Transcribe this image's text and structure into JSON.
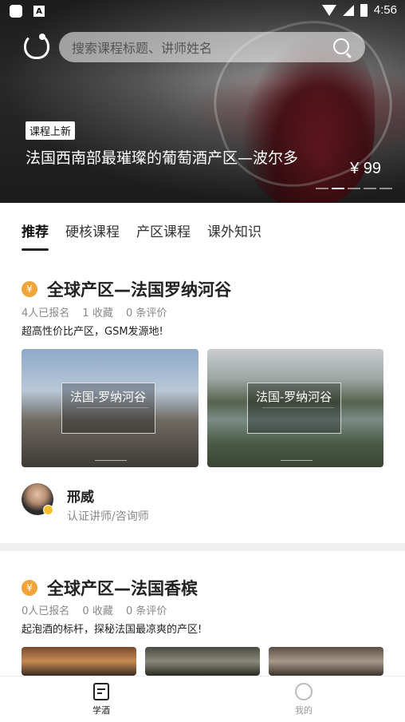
{
  "status_bar": {
    "time": "4:56",
    "left_icons": [
      "app-icon",
      "a-icon"
    ],
    "right_icons": [
      "wifi-icon",
      "signal-icon",
      "battery-icon"
    ]
  },
  "search": {
    "placeholder": "搜索课程标题、讲师姓名"
  },
  "hero": {
    "badge": "课程上新",
    "title": "法国西南部最璀璨的葡萄酒产区—波尔多",
    "price": "¥ 99",
    "dots_total": 5,
    "dots_active_index": 1
  },
  "tabs": [
    {
      "label": "推荐",
      "active": true
    },
    {
      "label": "硬核课程",
      "active": false
    },
    {
      "label": "产区课程",
      "active": false
    },
    {
      "label": "课外知识",
      "active": false
    }
  ],
  "courses": [
    {
      "title": "全球产区—法国罗纳河谷",
      "meta": {
        "enrolled": "4人已报名",
        "favorites": "1 收藏",
        "reviews": "0 条评价"
      },
      "desc": "超高性价比产区，GSM发源地!",
      "thumbs": [
        {
          "label": "法国-罗纳河谷"
        },
        {
          "label": "法国-罗纳河谷"
        }
      ],
      "lecturer": {
        "name": "邢威",
        "role": "认证讲师/咨询师"
      }
    },
    {
      "title": "全球产区—法国香槟",
      "meta": {
        "enrolled": "0人已报名",
        "favorites": "0 收藏",
        "reviews": "0 条评价"
      },
      "desc": "起泡酒的标杆，探秘法国最凉爽的产区!"
    }
  ],
  "bottom_nav": [
    {
      "label": "学酒",
      "icon": "document-icon",
      "active": true
    },
    {
      "label": "我的",
      "icon": "smile-icon",
      "active": false
    }
  ]
}
